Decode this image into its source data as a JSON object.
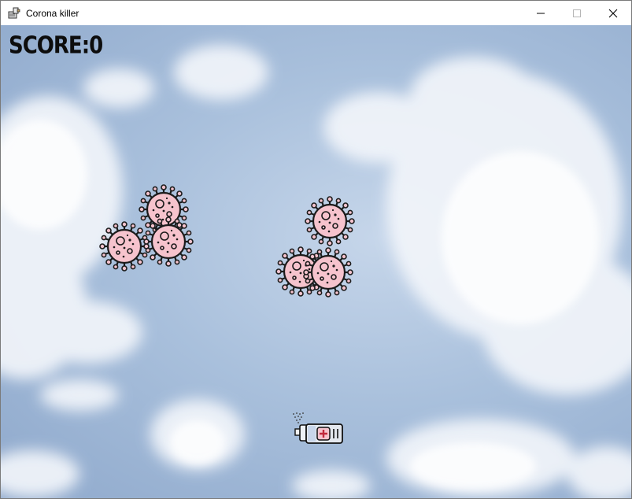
{
  "window": {
    "title": "Corona killer",
    "minimize_icon": "minimize-icon",
    "maximize_icon": "maximize-icon",
    "close_icon": "close-icon"
  },
  "game": {
    "score_text": "SCORE:0",
    "virus_count": 6,
    "virus_color": "#f6c3cd",
    "outline_color": "#1b1b1b",
    "sky_color": "#a9c0dc",
    "player_icon": "sanitizer-spray-icon"
  }
}
